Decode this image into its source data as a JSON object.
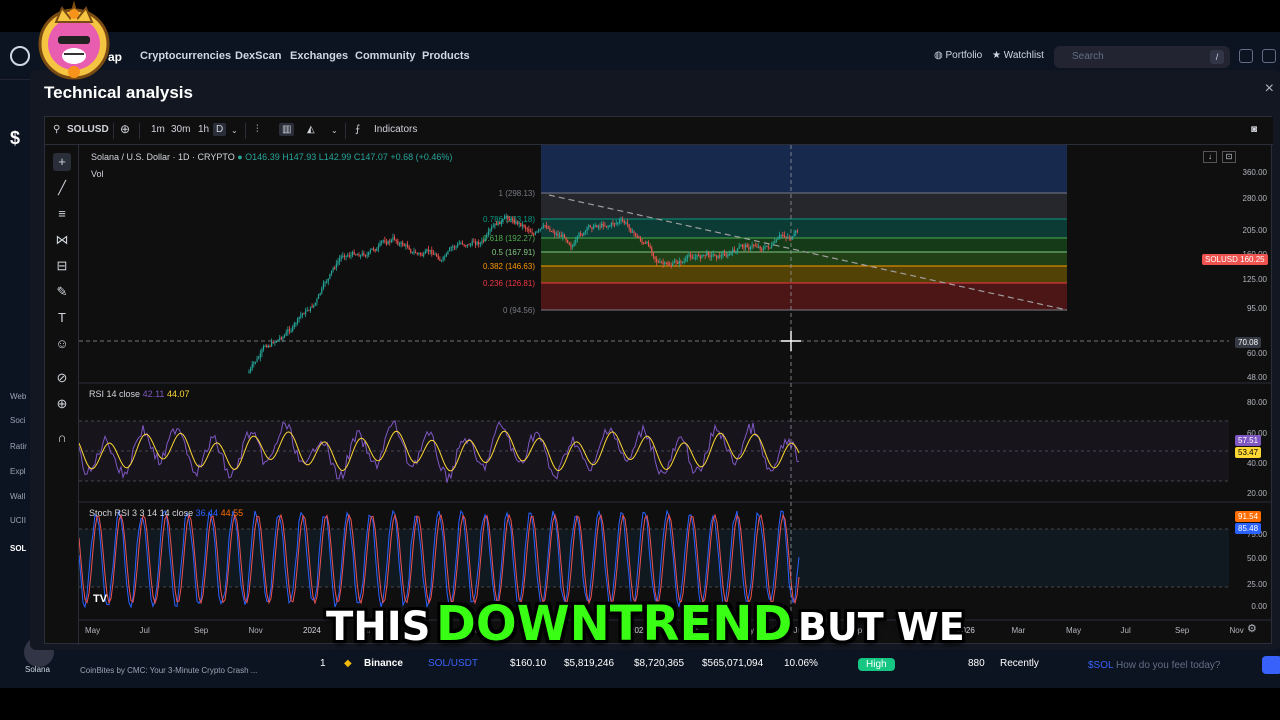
{
  "cmc": {
    "logo_text": "ap",
    "nav": [
      "Cryptocurrencies",
      "DexScan",
      "Exchanges",
      "Community",
      "Products"
    ],
    "portfolio": "Portfolio",
    "watchlist": "Watchlist",
    "search_placeholder": "Search",
    "search_shortcut": "/",
    "side_labels": [
      "Web",
      "Soci",
      "Ratir",
      "Expl",
      "Wall",
      "UCII",
      "SOL"
    ],
    "side_symbol": "$",
    "bottom_row": {
      "rank": "1",
      "exchange": "Binance",
      "pair": "SOL/USDT",
      "price": "$160.10",
      "depth_plus": "$5,819,246",
      "depth_minus": "$8,720,365",
      "volume": "$565,071,094",
      "volume_pct": "10.06%",
      "liquidity": "High",
      "score": "880",
      "updated": "Recently"
    },
    "news_text": "CoinBites by CMC: Your 3-Minute Crypto Crash ...",
    "avatar_label": "Solana",
    "feel_tag": "$SOL",
    "feel_text": "How do you feel today?"
  },
  "modal": {
    "title": "Technical analysis",
    "close": "×"
  },
  "toolbar": {
    "symbol": "SOLUSD",
    "intervals": [
      "1m",
      "30m",
      "1h",
      "D"
    ],
    "active_interval": "D",
    "indicators": "Indicators"
  },
  "chart": {
    "pair_title": "Solana / U.S. Dollar · 1D · CRYPTO",
    "open": "O146.39",
    "high": "H147.93",
    "low": "L142.99",
    "close": "C147.07",
    "change": "+0.68 (+0.46%)",
    "vol_label": "Vol",
    "current_price_tag": "SOLUSD",
    "current_price": "160.25",
    "crosshair_price": "70.08",
    "price_axis": [
      "360.00",
      "280.00",
      "205.00",
      "160.00",
      "125.00",
      "95.00",
      "60.00",
      "48.00"
    ],
    "fib_levels": [
      {
        "label": "1 (298.13)",
        "color": "#787b86"
      },
      {
        "label": "0.786 (233.18)",
        "color": "#089981"
      },
      {
        "label": "0.618 (192.27)",
        "color": "#4caf50"
      },
      {
        "label": "0.5 (167.91)",
        "color": "#81c784"
      },
      {
        "label": "0.382 (146.63)",
        "color": "#ff9800"
      },
      {
        "label": "0.236 (126.81)",
        "color": "#f23645"
      },
      {
        "label": "0 (94.56)",
        "color": "#787b86"
      }
    ],
    "x_axis": [
      "May",
      "Jul",
      "Sep",
      "Nov",
      "2024",
      "Mar",
      "May",
      "Jul",
      "Sep",
      "Nov",
      "2025",
      "Mar",
      "May",
      "Jul",
      "Sep",
      "Nov",
      "2026",
      "Mar",
      "May",
      "Jul",
      "Sep",
      "Nov"
    ]
  },
  "rsi": {
    "label": "RSI",
    "params": "14 close",
    "value1": "42.11",
    "value2": "44.07",
    "axis": [
      "80.00",
      "60.00",
      "40.00",
      "20.00"
    ],
    "tag1": "57.51",
    "tag2": "53.47"
  },
  "stoch": {
    "label": "Stoch RSI",
    "params": "3 3 14 14 close",
    "value1": "36.44",
    "value2": "44.55",
    "axis": [
      "75.00",
      "50.00",
      "25.00",
      "0.00"
    ],
    "tag1": "91.54",
    "tag2": "85.48"
  },
  "caption": {
    "word1": "THIS",
    "word2": "DOWNTREND",
    "word3": "BUT WE"
  }
}
